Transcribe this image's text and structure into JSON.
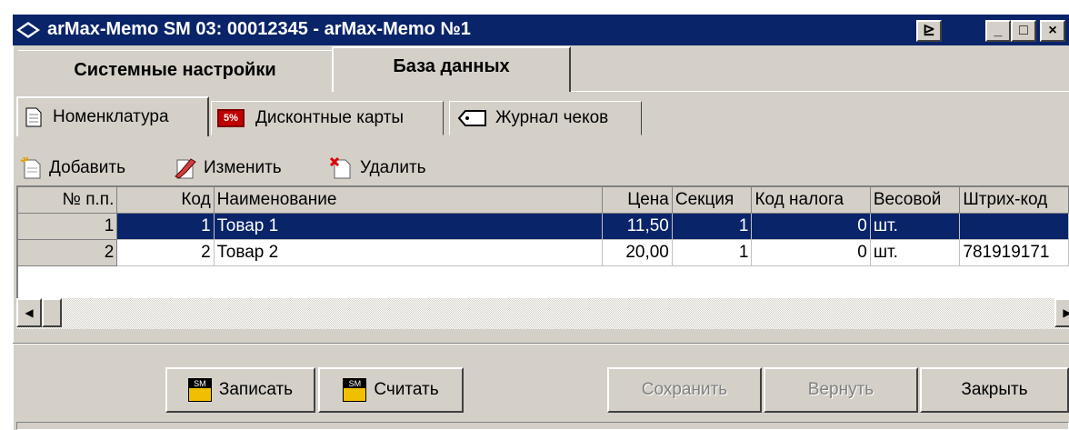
{
  "window": {
    "title": "arMax-Memo SM 03: 00012345 - arMax-Memo №1",
    "help_glyph": "⊵",
    "min_glyph": "_",
    "max_glyph": "□",
    "close_glyph": "×"
  },
  "main_tabs": [
    {
      "label": "Системные настройки",
      "active": false
    },
    {
      "label": "База данных",
      "active": true
    }
  ],
  "sub_tabs": [
    {
      "label": "Номенклатура",
      "icon": "document-icon",
      "active": true
    },
    {
      "label": "Дисконтные карты",
      "icon": "discount-card-icon",
      "icon_text": "5%",
      "active": false
    },
    {
      "label": "Журнал чеков",
      "icon": "receipt-tag-icon",
      "active": false
    }
  ],
  "toolbar": {
    "add_label": "Добавить",
    "edit_label": "Изменить",
    "delete_label": "Удалить"
  },
  "grid": {
    "columns": [
      "№ п.п.",
      "Код",
      "Наименование",
      "Цена",
      "Секция",
      "Код налога",
      "Весовой",
      "Штрих-код"
    ],
    "rows": [
      {
        "n": "1",
        "code": "1",
        "name": "Товар 1",
        "price": "11,50",
        "section": "1",
        "tax": "0",
        "weight": "шт.",
        "barcode": "",
        "selected": true
      },
      {
        "n": "2",
        "code": "2",
        "name": "Товар 2",
        "price": "20,00",
        "section": "1",
        "tax": "0",
        "weight": "шт.",
        "barcode": "781919171",
        "selected": false
      }
    ]
  },
  "scroll": {
    "left_glyph": "◀",
    "right_glyph": "▶"
  },
  "buttons": {
    "write_label": "Записать",
    "read_label": "Считать",
    "sm_icon_text": "SM",
    "save_label": "Сохранить",
    "revert_label": "Вернуть",
    "close_label": "Закрыть"
  },
  "colors": {
    "selection": "#0a246a",
    "face": "#d4d0c8",
    "titlebar": "#0a246a",
    "sm_icon": "#f0c000"
  }
}
